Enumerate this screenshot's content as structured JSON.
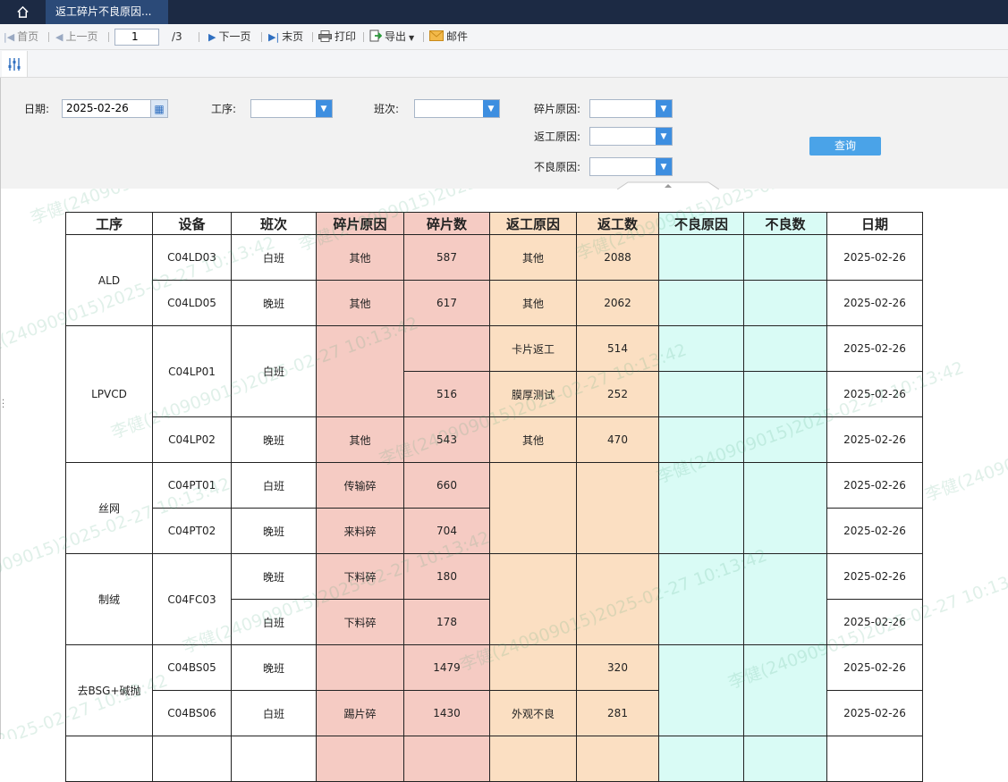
{
  "topbar": {
    "home_icon": "home-icon",
    "tab_label": "返工碎片不良原因..."
  },
  "toolbar": {
    "first_label": "首页",
    "prev_label": "上一页",
    "page_current": "1",
    "page_total": "/3",
    "next_label": "下一页",
    "last_label": "末页",
    "print_label": "打印",
    "export_label": "导出",
    "mail_label": "邮件"
  },
  "form": {
    "date_label": "日期:",
    "date_value": "2025-02-26",
    "process_label": "工序:",
    "shift_label": "班次:",
    "fragment_reason_label": "碎片原因:",
    "rework_reason_label": "返工原因:",
    "defect_reason_label": "不良原因:",
    "query_label": "查询"
  },
  "table": {
    "headers": [
      "工序",
      "设备",
      "班次",
      "碎片原因",
      "碎片数",
      "返工原因",
      "返工数",
      "不良原因",
      "不良数",
      "日期"
    ],
    "groups": [
      {
        "process": "ALD",
        "rows": [
          {
            "device": "C04LD03",
            "shift": "白班",
            "frag_reason": "其他",
            "frag_count": "587",
            "rework_reason": "其他",
            "rework_count": "2088",
            "defect_reason": "",
            "defect_count": "",
            "date": "2025-02-26"
          },
          {
            "device": "C04LD05",
            "shift": "晚班",
            "frag_reason": "其他",
            "frag_count": "617",
            "rework_reason": "其他",
            "rework_count": "2062",
            "defect_reason": "",
            "defect_count": "",
            "date": "2025-02-26"
          }
        ]
      },
      {
        "process": "LPVCD",
        "rows": [
          {
            "device": "C04LP01",
            "shift": "白班",
            "frag_reason": "",
            "frag_count": "",
            "rework_reason": "卡片返工",
            "rework_count": "514",
            "defect_reason": "",
            "defect_count": "",
            "date": "2025-02-26"
          },
          {
            "device": "",
            "shift": "",
            "frag_reason": "",
            "frag_count": "516",
            "rework_reason": "膜厚测试",
            "rework_count": "252",
            "defect_reason": "",
            "defect_count": "",
            "date": "2025-02-26"
          },
          {
            "device": "C04LP02",
            "shift": "晚班",
            "frag_reason": "其他",
            "frag_count": "543",
            "rework_reason": "其他",
            "rework_count": "470",
            "defect_reason": "",
            "defect_count": "",
            "date": "2025-02-26"
          }
        ]
      },
      {
        "process": "丝网",
        "rows": [
          {
            "device": "C04PT01",
            "shift": "白班",
            "frag_reason": "传输碎",
            "frag_count": "660",
            "rework_reason": "",
            "rework_count": "",
            "defect_reason": "",
            "defect_count": "",
            "date": "2025-02-26"
          },
          {
            "device": "C04PT02",
            "shift": "晚班",
            "frag_reason": "来料碎",
            "frag_count": "704",
            "rework_reason": "",
            "rework_count": "",
            "defect_reason": "",
            "defect_count": "",
            "date": "2025-02-26"
          }
        ]
      },
      {
        "process": "制绒",
        "rows": [
          {
            "device": "C04FC03",
            "shift": "晚班",
            "frag_reason": "下料碎",
            "frag_count": "180",
            "rework_reason": "",
            "rework_count": "",
            "defect_reason": "",
            "defect_count": "",
            "date": "2025-02-26"
          },
          {
            "device": "",
            "shift": "白班",
            "frag_reason": "下料碎",
            "frag_count": "178",
            "rework_reason": "",
            "rework_count": "",
            "defect_reason": "",
            "defect_count": "",
            "date": "2025-02-26"
          }
        ]
      },
      {
        "process": "去BSG+碱抛",
        "rows": [
          {
            "device": "C04BS05",
            "shift": "晚班",
            "frag_reason": "",
            "frag_count": "1479",
            "rework_reason": "",
            "rework_count": "320",
            "defect_reason": "",
            "defect_count": "",
            "date": "2025-02-26"
          },
          {
            "device": "C04BS06",
            "shift": "白班",
            "frag_reason": "踢片碎",
            "frag_count": "1430",
            "rework_reason": "外观不良",
            "rework_count": "281",
            "defect_reason": "",
            "defect_count": "",
            "date": "2025-02-26"
          }
        ]
      }
    ]
  },
  "watermark": {
    "text": "李健(240909015)2025-02-27 10:13:42"
  },
  "colors": {
    "fragment_bg": "#f5cbc3",
    "rework_bg": "#fbdfc2",
    "defect_bg": "#d9fbf5",
    "primary": "#3d8ee0",
    "topbar": "#1c2a44"
  }
}
